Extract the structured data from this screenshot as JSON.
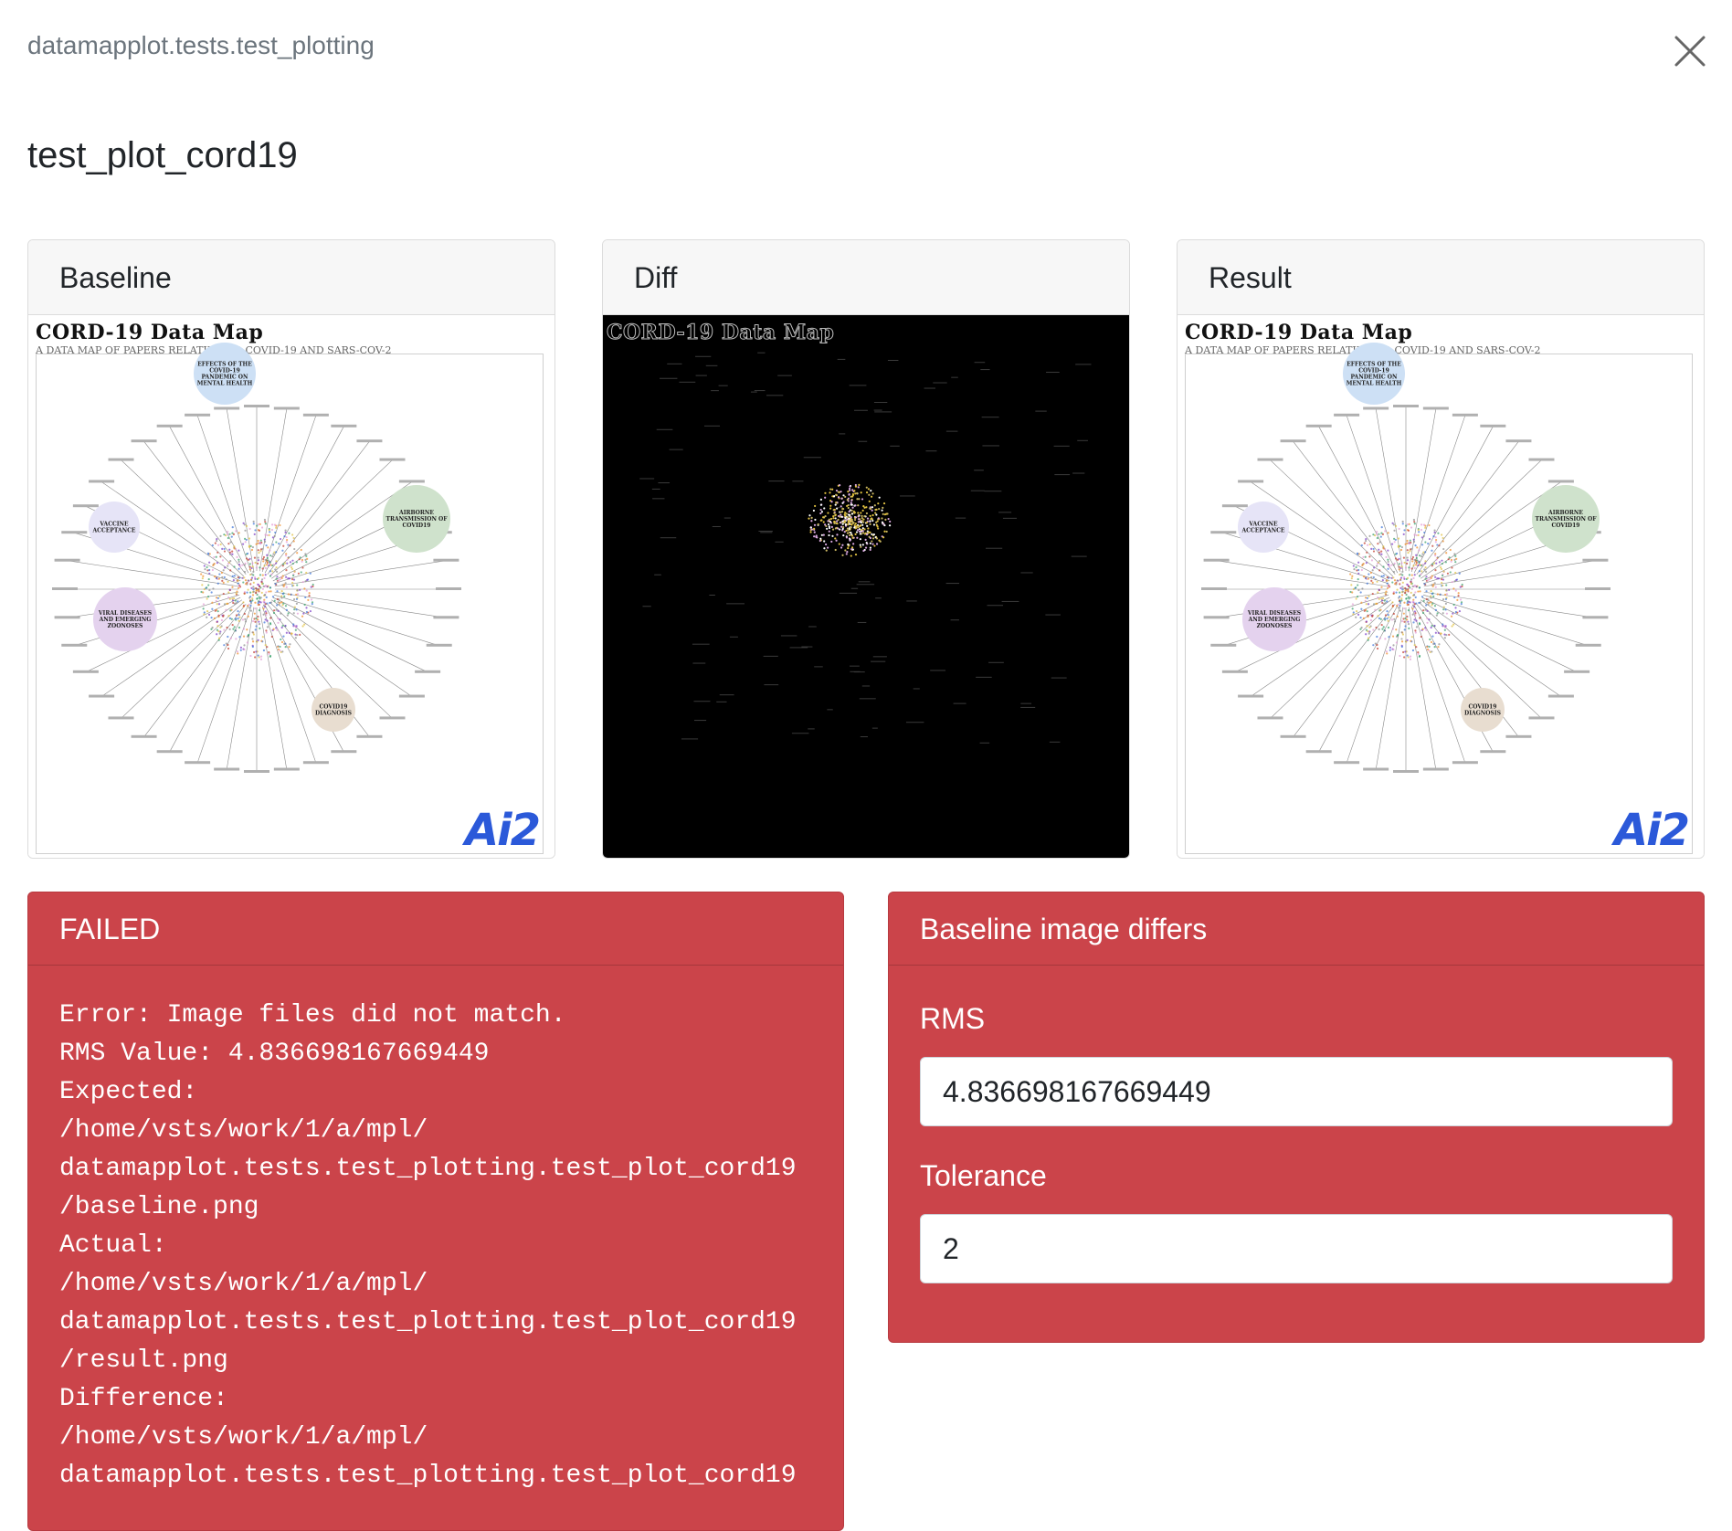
{
  "header": {
    "module_name": "datamapplot.tests.test_plotting",
    "test_name": "test_plot_cord19",
    "close_icon": "close-icon"
  },
  "images": {
    "baseline_label": "Baseline",
    "diff_label": "Diff",
    "result_label": "Result"
  },
  "datamap": {
    "title": "CORD-19 Data Map",
    "subtitle": "A DATA MAP OF PAPERS RELATING TO COVID-19 AND SARS-COV-2",
    "logo": "Ai2",
    "bubble_labels": [
      "EFFECTS OF THE COVID-19 PANDEMIC ON MENTAL HEALTH",
      "AIRBORNE TRANSMISSION OF COVID19",
      "VACCINE ACCEPTANCE",
      "VIRAL DISEASES AND EMERGING ZOONOSES",
      "COVID19 DIAGNOSIS"
    ],
    "bubble_colors": [
      "#cde0f5",
      "#cfe2cc",
      "#e6e4f7",
      "#e4d2ee",
      "#e8ddd0"
    ],
    "cluster_colors": [
      "#3a74d8",
      "#36a06a",
      "#e39ad5",
      "#7a3cc4",
      "#e0c040",
      "#c0392b",
      "#f08a24",
      "#8a8a8a"
    ]
  },
  "status_panel": {
    "title": "FAILED",
    "message": "Error: Image files did not match.\nRMS Value: 4.836698167669449\nExpected:\n/home/vsts/work/1/a/mpl/\ndatamapplot.tests.test_plotting.test_plot_cord19\n/baseline.png\nActual:\n/home/vsts/work/1/a/mpl/\ndatamapplot.tests.test_plotting.test_plot_cord19\n/result.png\nDifference:\n/home/vsts/work/1/a/mpl/\ndatamapplot.tests.test_plotting.test_plot_cord19"
  },
  "details_panel": {
    "title": "Baseline image differs",
    "rms_label": "RMS",
    "rms_value": "4.836698167669449",
    "tolerance_label": "Tolerance",
    "tolerance_value": "2"
  },
  "colors": {
    "failed_red": "#cb444a",
    "muted_text": "#6c757d",
    "card_header_bg": "#f7f7f7"
  }
}
